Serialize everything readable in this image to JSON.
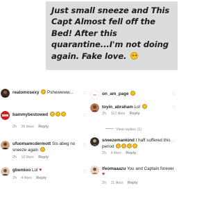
{
  "caption": {
    "line1": "Just small sneeze and This",
    "line2": "Capt  Almost fell off the",
    "line3": "Bed! After this",
    "line4": "quarantine...I'm not doing",
    "line5": "again. Fake love."
  },
  "left_comments": [
    {
      "username": "realomosexy",
      "text": "Pshewwww...",
      "emojis": "",
      "meta": [],
      "reply": "",
      "view_replies": ""
    },
    {
      "username": "bammybestowed",
      "text": "",
      "emojis": "laugh x3",
      "meta": [
        "2h",
        "36 likes"
      ],
      "reply": "Reply",
      "view_replies": ""
    },
    {
      "username": "ufuomamcdermott",
      "text": "Sis abeg no sneeze again",
      "emojis": "laugh",
      "meta": [
        "2h",
        "10 likes"
      ],
      "reply": "Reply",
      "view_replies": ""
    },
    {
      "username": "gbemioo",
      "text": "Lol",
      "emojis": "heart",
      "meta": [
        "2h",
        "4 likes"
      ],
      "reply": "Reply",
      "view_replies": ""
    }
  ],
  "right_comments": [
    {
      "username": "on_am_page",
      "text": "",
      "emojis": "laugh",
      "meta": [],
      "reply": "",
      "view_replies": ""
    },
    {
      "username": "toyin_abraham",
      "text": "Lol",
      "emojis": "laugh",
      "meta": [
        "2h",
        "112 likes"
      ],
      "reply": "Reply",
      "view_replies": "View replies (1)"
    },
    {
      "username": "sneezemankind",
      "text": "I haff suffered this period",
      "emojis": "laugh x4",
      "meta": [
        "2h",
        "4 likes"
      ],
      "reply": "Reply",
      "view_replies": ""
    },
    {
      "username": "ifeomaaazu",
      "text": "You and Captain forever",
      "emojis": "heart",
      "meta": [
        "2h",
        "11 likes"
      ],
      "reply": "Reply",
      "view_replies": ""
    }
  ],
  "icons": {
    "like": "heart-outline-icon",
    "emoji": "laughing-face-icon",
    "heart": "red-heart-icon"
  },
  "colors": {
    "caption_bg": "#dcdcdc",
    "text": "#262626",
    "meta": "#8e8e8e",
    "heart": "#e0244a",
    "emoji": "#f5c22b"
  }
}
